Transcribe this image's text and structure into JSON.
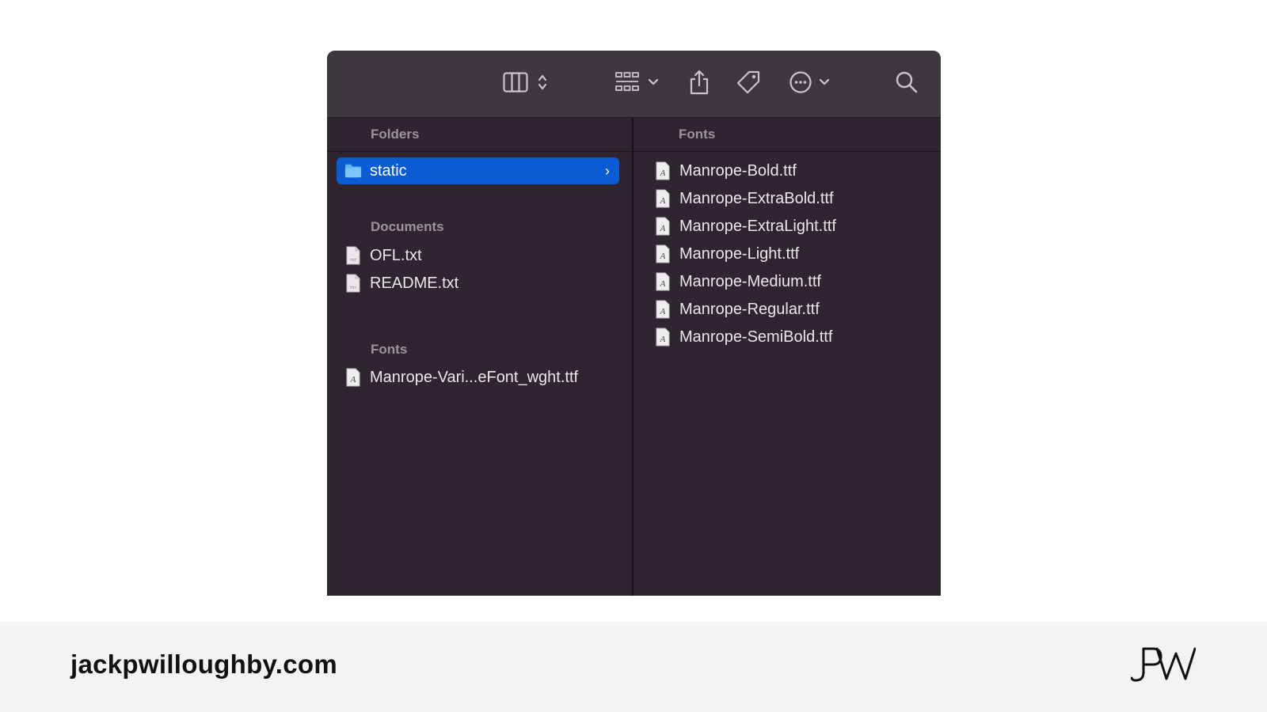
{
  "toolbar": {
    "icons": [
      "columns-view-icon",
      "sort-arrows-icon",
      "grid-group-icon",
      "chevron-down-icon",
      "share-icon",
      "tag-icon",
      "more-ellipsis-icon",
      "chevron-down-icon",
      "search-icon"
    ]
  },
  "left_column": {
    "folders_label": "Folders",
    "selected_folder": "static",
    "documents_label": "Documents",
    "documents": [
      "OFL.txt",
      "README.txt"
    ],
    "fonts_label": "Fonts",
    "fonts": [
      "Manrope-Vari...eFont_wght.ttf"
    ]
  },
  "right_column": {
    "header": "Fonts",
    "files": [
      "Manrope-Bold.ttf",
      "Manrope-ExtraBold.ttf",
      "Manrope-ExtraLight.ttf",
      "Manrope-Light.ttf",
      "Manrope-Medium.ttf",
      "Manrope-Regular.ttf",
      "Manrope-SemiBold.ttf"
    ]
  },
  "footer": {
    "site": "jackpwilloughby.com",
    "logo_text": "JPW"
  },
  "colors": {
    "window_bg": "#2f2530",
    "toolbar_bg": "#3f373f",
    "selection": "#0b5bd3",
    "footer_bg": "#f3f3f3"
  }
}
